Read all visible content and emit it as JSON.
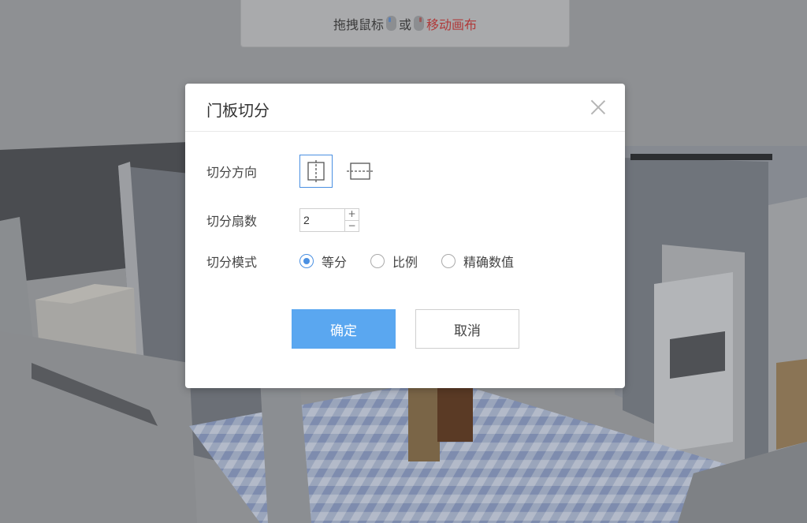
{
  "hint": {
    "text_drag": "拖拽鼠标",
    "text_or": "或",
    "text_move": "移动画布",
    "left_mouse_icon": "mouse-left-icon",
    "right_mouse_icon": "mouse-right-icon"
  },
  "dialog": {
    "title": "门板切分",
    "close_icon": "close-icon",
    "direction": {
      "label": "切分方向",
      "options": [
        {
          "icon": "vertical-split-icon",
          "selected": true
        },
        {
          "icon": "horizontal-split-icon",
          "selected": false
        }
      ]
    },
    "count": {
      "label": "切分扇数",
      "value": "2",
      "plus": "+",
      "minus": "−"
    },
    "mode": {
      "label": "切分模式",
      "options": [
        {
          "label": "等分",
          "selected": true
        },
        {
          "label": "比例",
          "selected": false
        },
        {
          "label": "精确数值",
          "selected": false
        }
      ]
    },
    "confirm_label": "确定",
    "cancel_label": "取消"
  },
  "colors": {
    "accent": "#4a90e2",
    "primary_button": "#5aa7f0",
    "highlight_text": "#b03a3a"
  }
}
